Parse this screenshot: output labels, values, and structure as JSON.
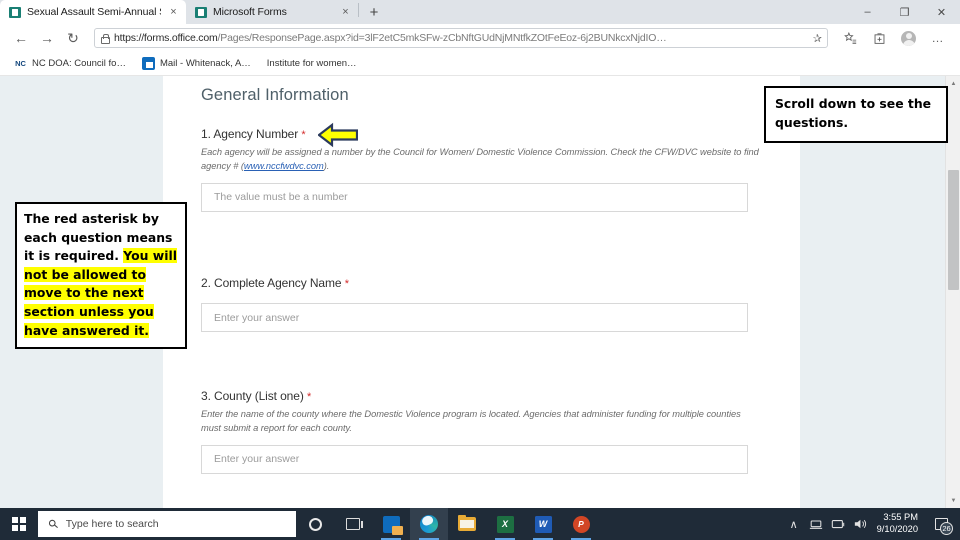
{
  "browser": {
    "tabs": [
      {
        "title": "Sexual Assault Semi-Annual Stati",
        "favicon": "forms-icon",
        "active": true,
        "close_label": "×"
      },
      {
        "title": "Microsoft Forms",
        "favicon": "forms-icon",
        "active": false,
        "close_label": "×"
      }
    ],
    "new_tab_label": "+",
    "window_controls": {
      "minimize": "–",
      "maximize": "❐",
      "close": "✕"
    },
    "nav": {
      "back": "←",
      "forward": "→",
      "refresh": "↻"
    },
    "address": {
      "url_bold": "https://forms.office.com",
      "url_dim": "/Pages/ResponsePage.aspx?id=3lF2etC5mkSFw-zCbNftGUdNjMNtfkZOtFeEoz-6j2BUNkcxNjdIO…",
      "lock": "lock-icon",
      "star": "✰"
    },
    "toolbar_icons": [
      "favorites-star-icon",
      "favorites-list-icon",
      "collections-icon",
      "profile-avatar-icon",
      "settings-more-icon"
    ],
    "settings_label": "…",
    "bookmarks": [
      {
        "label": "NC DOA: Council fo…",
        "icon": "nc-icon",
        "icon_text": "NC"
      },
      {
        "label": "Mail - Whitenack, A…",
        "icon": "outlook-icon",
        "icon_text": ""
      },
      {
        "label": "Institute for women…",
        "icon": "page-icon",
        "icon_text": ""
      }
    ]
  },
  "form": {
    "section_title": "General Information",
    "questions": [
      {
        "number": "1.",
        "label": "Agency Number",
        "required_mark": "*",
        "description_before": "Each agency will be assigned a number by the Council for Women/ Domestic Violence Commission. Check the CFW/DVC website to find agency # (",
        "link_text": "www.nccfwdvc.com",
        "description_after": ").",
        "placeholder": "The value must be a number"
      },
      {
        "number": "2.",
        "label": "Complete Agency Name",
        "required_mark": "*",
        "description_before": "",
        "link_text": "",
        "description_after": "",
        "placeholder": "Enter your answer"
      },
      {
        "number": "3.",
        "label": "County (List one)",
        "required_mark": "*",
        "description_before": "Enter the name of the county where the Domestic Violence program is located. Agencies that administer funding for multiple counties must submit a report for each county.",
        "link_text": "",
        "description_after": "",
        "placeholder": "Enter your answer"
      }
    ],
    "scrollbar": {
      "up_arrow": "▲",
      "down_arrow": "▼"
    }
  },
  "annotations": {
    "left_box": {
      "plain_text": "The red asterisk by each question means it is required. ",
      "highlighted_text": "You will not be allowed to move to the next section unless you have answered it."
    },
    "right_box": {
      "text": "Scroll down to see the questions."
    },
    "arrow": {
      "name": "left-pointing-arrow",
      "fill": "#FFFF00",
      "stroke": "#2b3a5c"
    }
  },
  "taskbar": {
    "start_label": "Start",
    "search_placeholder": "Type here to search",
    "search_icon": "magnifier-icon",
    "buttons": [
      "cortana-icon",
      "task-view-icon"
    ],
    "apps": [
      {
        "name": "outlook-app",
        "label": "Outlook",
        "active": false,
        "running": true
      },
      {
        "name": "edge-app",
        "label": "Microsoft Edge",
        "active": true,
        "running": true
      },
      {
        "name": "file-explorer-app",
        "label": "File Explorer",
        "active": false,
        "running": false
      },
      {
        "name": "excel-app",
        "label": "Excel",
        "letter": "X",
        "active": false,
        "running": true
      },
      {
        "name": "word-app",
        "label": "Word",
        "letter": "W",
        "active": false,
        "running": true
      },
      {
        "name": "powerpoint-app",
        "label": "PowerPoint",
        "letter": "P",
        "active": false,
        "running": true
      }
    ],
    "tray": {
      "chevron": "∧",
      "network": "🖴",
      "display": "▭",
      "volume": "🔊"
    },
    "clock": {
      "time": "3:55 PM",
      "date": "9/10/2020"
    },
    "notifications": {
      "count": "26"
    }
  }
}
